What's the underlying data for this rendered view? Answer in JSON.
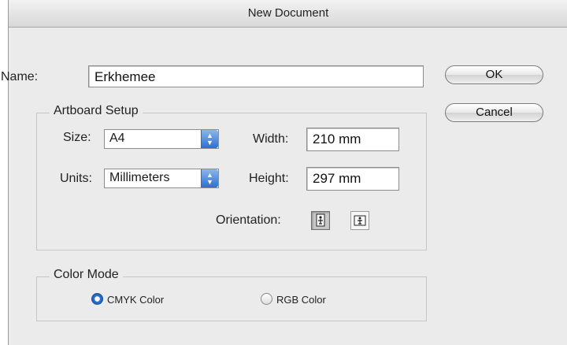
{
  "window": {
    "title": "New Document"
  },
  "name_field": {
    "label": "Name:",
    "value": "Erkhemee"
  },
  "buttons": {
    "ok": "OK",
    "cancel": "Cancel"
  },
  "artboard": {
    "title": "Artboard Setup",
    "size_label": "Size:",
    "size_value": "A4",
    "units_label": "Units:",
    "units_value": "Millimeters",
    "width_label": "Width:",
    "width_value": "210 mm",
    "height_label": "Height:",
    "height_value": "297 mm",
    "orientation_label": "Orientation:",
    "orientation_selected": "portrait"
  },
  "color_mode": {
    "title": "Color Mode",
    "options": [
      {
        "label": "CMYK Color",
        "checked": true
      },
      {
        "label": "RGB Color",
        "checked": false
      }
    ]
  },
  "colors": {
    "accent": "#2f76d6",
    "dialog_bg": "#ebebeb"
  }
}
